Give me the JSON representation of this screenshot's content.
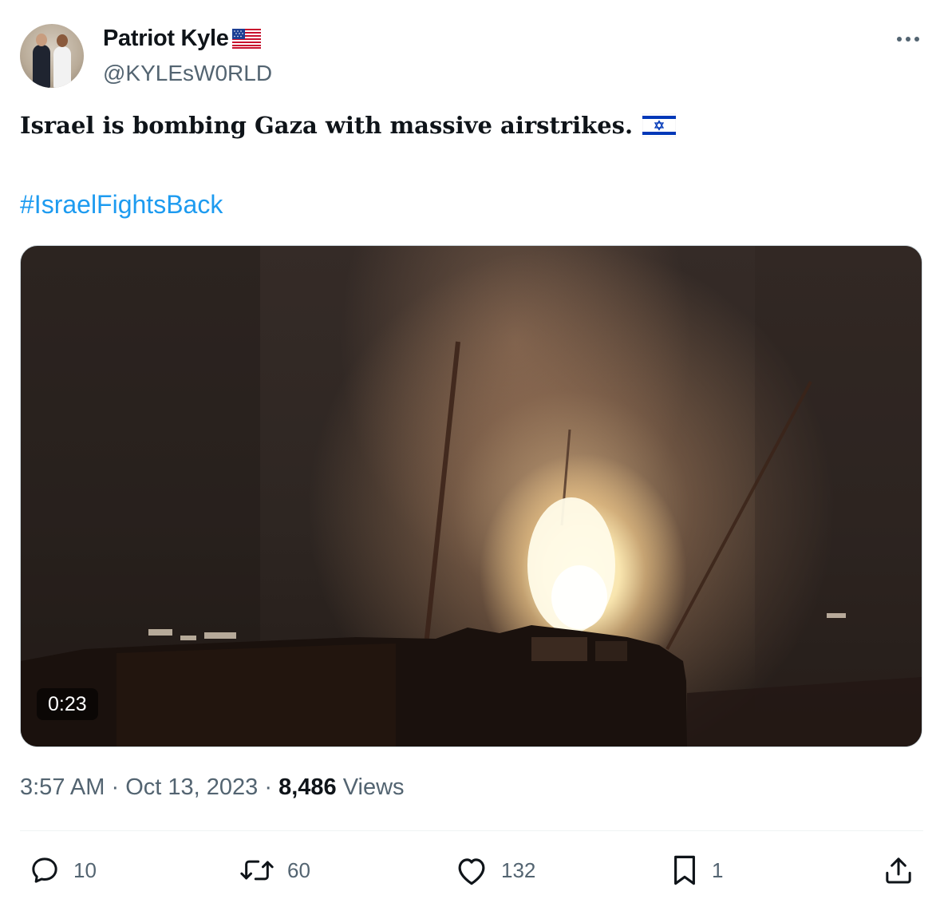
{
  "author": {
    "display_name": "Patriot Kyle",
    "name_emoji": "us-flag",
    "handle": "@KYLEsW0RLD",
    "avatar": "avatar-photo"
  },
  "tweet": {
    "text": "Israel is bombing Gaza with massive airstrikes.",
    "text_emoji": "israel-flag",
    "hashtag": "#IsraelFightsBack"
  },
  "media": {
    "type": "video",
    "duration": "0:23"
  },
  "meta": {
    "time": "3:57 AM",
    "separator": "·",
    "date": "Oct 13, 2023",
    "views_count": "8,486",
    "views_label": "Views"
  },
  "actions": {
    "replies": "10",
    "retweets": "60",
    "likes": "132",
    "bookmarks": "1"
  },
  "icons": [
    "more-icon",
    "reply-icon",
    "retweet-icon",
    "like-icon",
    "bookmark-icon",
    "share-icon"
  ],
  "colors": {
    "text_primary": "#0f1419",
    "text_secondary": "#536471",
    "link": "#1d9bf0",
    "divider": "#eff3f4"
  }
}
